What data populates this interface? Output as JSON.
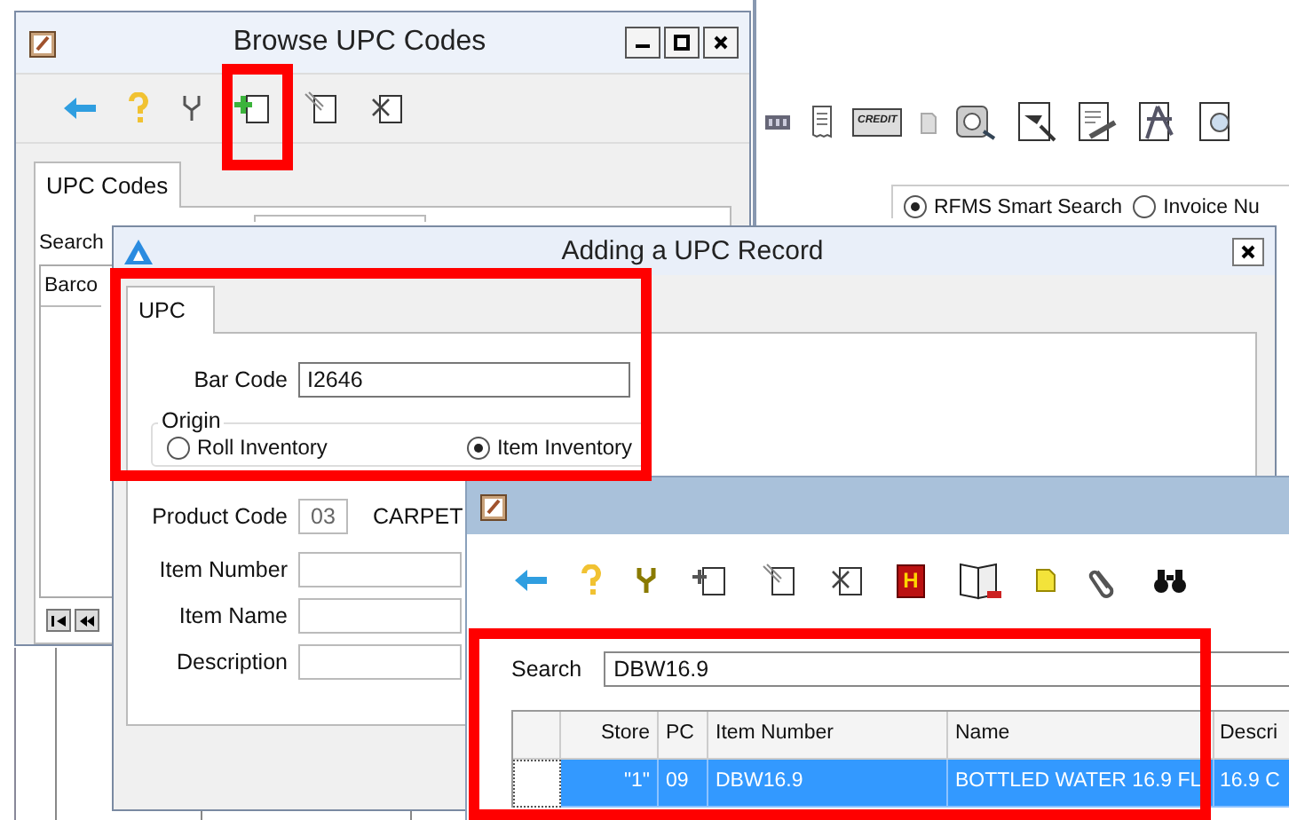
{
  "browse_window": {
    "title": "Browse UPC Codes",
    "tab": "UPC Codes",
    "search_label": "Search",
    "grid_column": "Barco"
  },
  "search_window": {
    "card_icon_text": "CREDIT",
    "radios": [
      {
        "label": "RFMS Smart Search",
        "selected": true
      },
      {
        "label": "Invoice Nu",
        "selected": false
      }
    ]
  },
  "dialog": {
    "title": "Adding a UPC Record",
    "tab": "UPC",
    "bar_code": {
      "label": "Bar Code",
      "value": "I2646"
    },
    "origin": {
      "label": "Origin",
      "options": [
        {
          "label": "Roll Inventory",
          "selected": false
        },
        {
          "label": "Item Inventory",
          "selected": true
        }
      ]
    },
    "product_code": {
      "label": "Product Code",
      "value": "03",
      "name": "CARPET"
    },
    "fields": [
      {
        "label": "Item Number"
      },
      {
        "label": "Item Name"
      },
      {
        "label": "Description"
      }
    ]
  },
  "item_window": {
    "help_icon_letter": "H",
    "search": {
      "label": "Search",
      "value": "DBW16.9"
    },
    "columns": [
      "Store",
      "PC",
      "Item Number",
      "Name",
      "Descri"
    ],
    "rows": [
      {
        "cells": [
          "\"1\"",
          "09",
          "DBW16.9",
          "BOTTLED WATER 16.9 FL",
          "16.9 C"
        ],
        "selected": true
      }
    ]
  }
}
